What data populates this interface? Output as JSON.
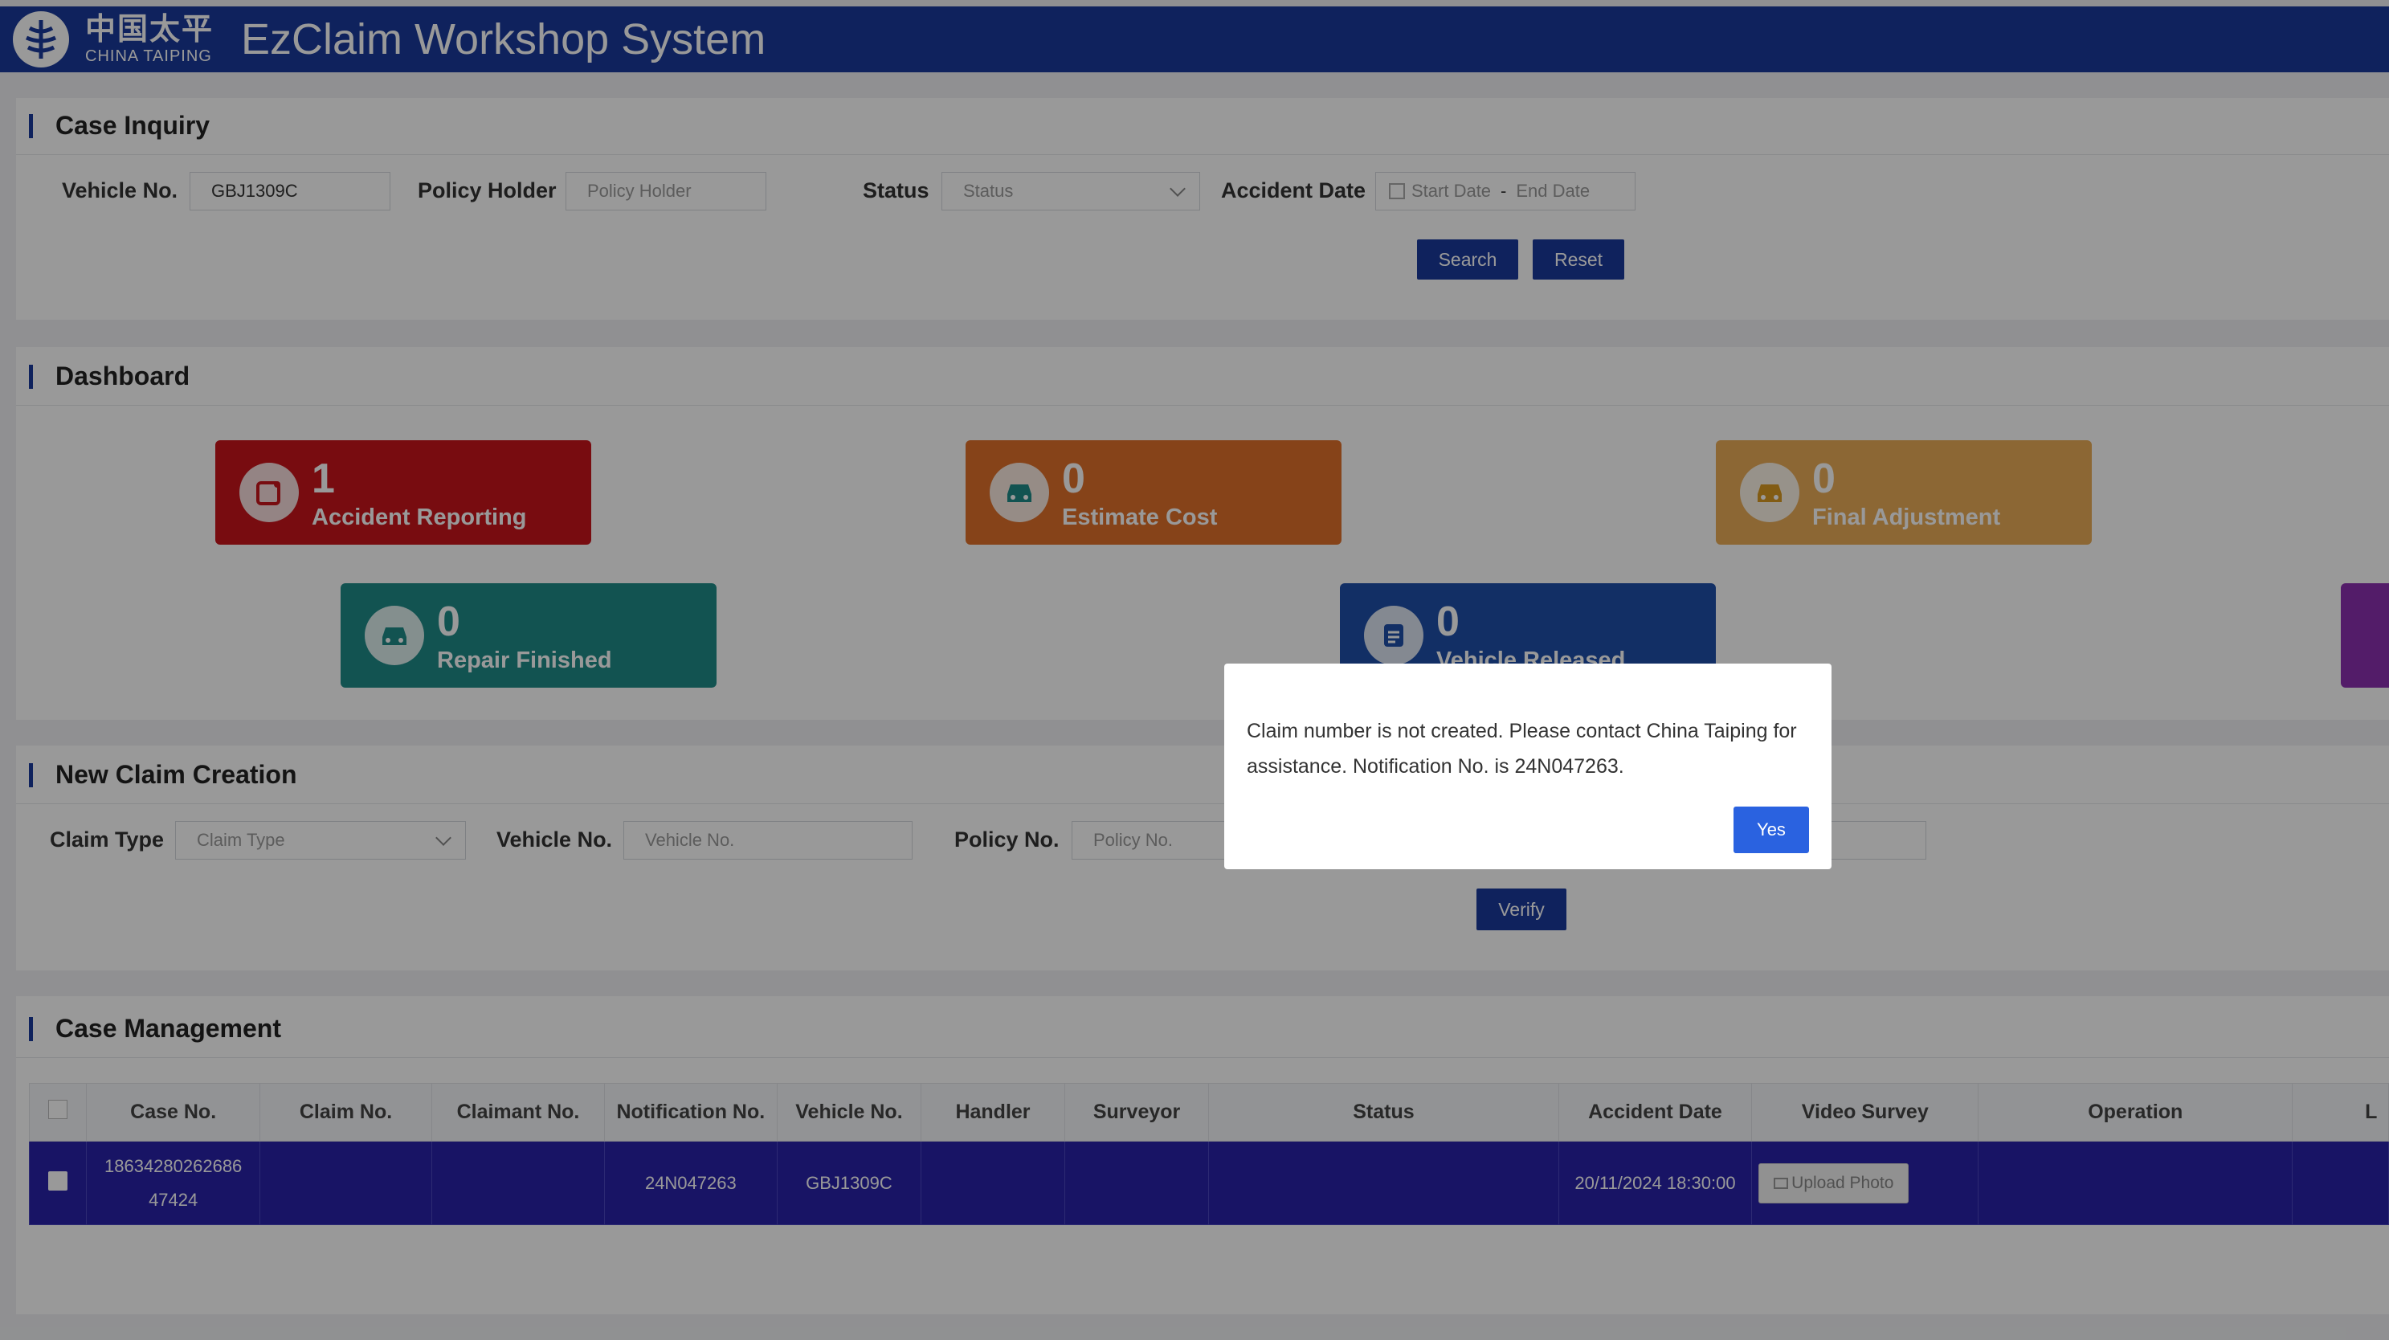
{
  "header": {
    "logo_cn": "中国太平",
    "logo_en": "CHINA TAIPING",
    "title": "EzClaim Workshop System"
  },
  "inquiry": {
    "title": "Case Inquiry",
    "vehicle_label": "Vehicle No.",
    "vehicle_value": "GBJ1309C",
    "holder_label": "Policy Holder",
    "holder_placeholder": "Policy Holder",
    "status_label": "Status",
    "status_placeholder": "Status",
    "date_label": "Accident Date",
    "date_start": "Start Date",
    "date_sep": "-",
    "date_end": "End Date",
    "search": "Search",
    "reset": "Reset"
  },
  "dashboard": {
    "title": "Dashboard",
    "cards": [
      {
        "count": "1",
        "label": "Accident Reporting",
        "color": "#c8151c",
        "icon": "clipboard-icon"
      },
      {
        "count": "0",
        "label": "Estimate Cost",
        "color": "#e0702a",
        "icon": "car-icon"
      },
      {
        "count": "0",
        "label": "Final Adjustment",
        "color": "#e9ac58",
        "icon": "car-icon"
      },
      {
        "count": "0",
        "label": "Repair Finished",
        "color": "#1e8a88",
        "icon": "car-icon"
      },
      {
        "count": "0",
        "label": "Vehicle Released",
        "color": "#1f4fa8",
        "icon": "document-icon"
      }
    ]
  },
  "new_claim": {
    "title": "New Claim Creation",
    "type_label": "Claim Type",
    "type_placeholder": "Claim Type",
    "vehicle_label": "Vehicle No.",
    "vehicle_placeholder": "Vehicle No.",
    "policy_label": "Policy No.",
    "policy_placeholder": "Policy No.",
    "verify": "Verify"
  },
  "case_mgmt": {
    "title": "Case Management",
    "columns": [
      "Case No.",
      "Claim No.",
      "Claimant No.",
      "Notification No.",
      "Vehicle No.",
      "Handler",
      "Surveyor",
      "Status",
      "Accident Date",
      "Video Survey",
      "Operation",
      "L"
    ],
    "row": {
      "case_no_1": "18634280262686",
      "case_no_2": "47424",
      "claim_no": "",
      "claimant_no": "",
      "notification_no": "24N047263",
      "vehicle_no": "GBJ1309C",
      "handler": "",
      "surveyor": "",
      "status": "",
      "accident_date": "20/11/2024 18:30:00",
      "upload": "Upload Photo",
      "operation": ""
    }
  },
  "dialog": {
    "message": "Claim number is not created. Please contact China Taiping for assistance. Notification No. is 24N047263.",
    "yes": "Yes"
  },
  "colors": {
    "brand": "#1a3a9c",
    "selected_row": "#2822a8",
    "dialog_button": "#2a62e0"
  }
}
